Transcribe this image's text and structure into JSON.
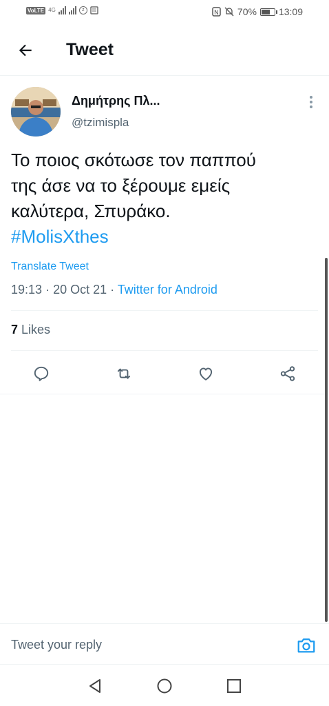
{
  "status_bar": {
    "network_label": "VoLTE",
    "network_gen": "4G",
    "battery_percent_label": "70%",
    "battery_level": 0.7,
    "time": "13:09"
  },
  "header": {
    "title": "Tweet",
    "back_icon": "back-arrow-icon"
  },
  "tweet": {
    "display_name": "Δημήτρης Πλ...",
    "handle": "@tzimispla",
    "text_lines": [
      "Το ποιος σκότωσε τον παππού",
      "της άσε να το ξέρουμε εμείς",
      "καλύτερα, Σπυράκο."
    ],
    "hashtag": "#MolisXthes",
    "translate_label": "Translate Tweet",
    "time": "19:13",
    "date": "20 Oct 21",
    "source": "Twitter for Android",
    "likes_count": "7",
    "likes_label": "Likes"
  },
  "actions": [
    "reply-icon",
    "retweet-icon",
    "like-icon",
    "share-icon"
  ],
  "reply_bar": {
    "placeholder": "Tweet your reply"
  },
  "nav": [
    "back-triangle-icon",
    "home-circle-icon",
    "recents-square-icon"
  ],
  "colors": {
    "accent": "#1d9bf0",
    "text": "#0f1419",
    "secondary": "#536471",
    "divider": "#eff3f4"
  }
}
